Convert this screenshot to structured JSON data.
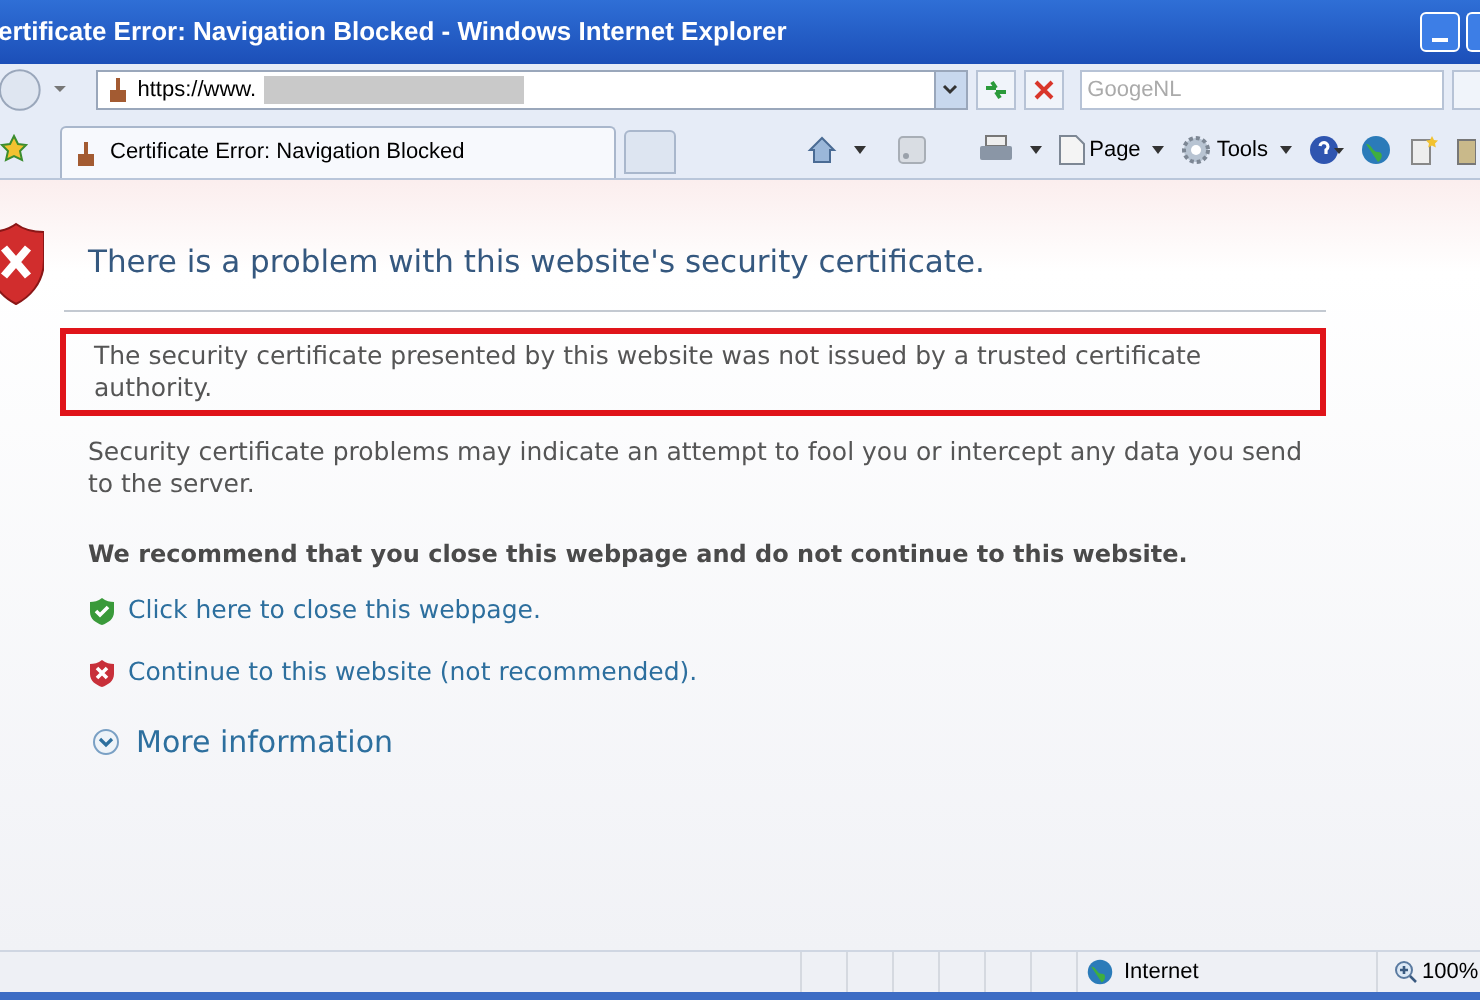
{
  "window": {
    "title": "ertificate Error: Navigation Blocked - Windows Internet Explorer"
  },
  "address_bar": {
    "value": "https://www."
  },
  "search": {
    "placeholder": "GoogeNL"
  },
  "tabs": [
    {
      "label": "Certificate Error: Navigation Blocked",
      "selected": true
    }
  ],
  "command_bar": {
    "page_label": "Page",
    "tools_label": "Tools"
  },
  "content": {
    "heading": "There is a problem with this website's security certificate.",
    "warning": {
      "text": "The security certificate presented by this website was not issued by a trusted certificate authority.",
      "highlighted": true
    },
    "explanation": "Security certificate problems may indicate an attempt to fool you or intercept any data you send to the server.",
    "recommendation": "We recommend that you close this webpage and do not continue to this website.",
    "actions": [
      {
        "kind": "safe",
        "label": "Click here to close this webpage."
      },
      {
        "kind": "unsafe",
        "label": "Continue to this website (not recommended)."
      }
    ],
    "more_info": {
      "label": "More information",
      "expanded": false
    }
  },
  "status_bar": {
    "zone": "Internet",
    "zoom": "100%"
  }
}
